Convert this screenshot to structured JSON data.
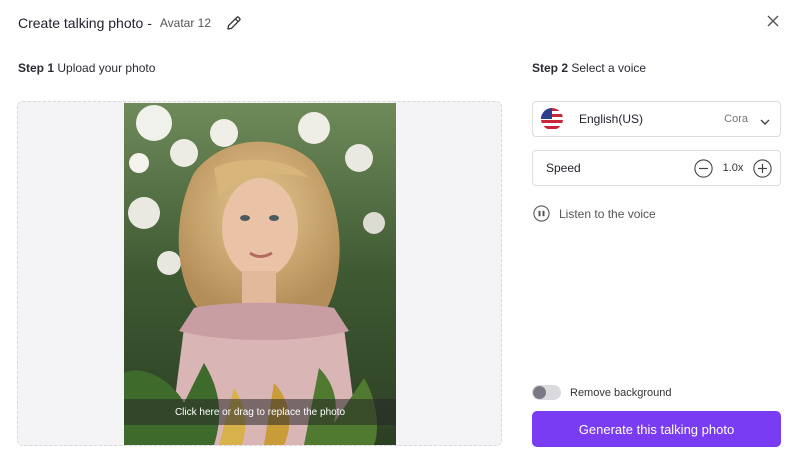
{
  "header": {
    "title": "Create talking photo -",
    "avatar_name": "Avatar 12",
    "edit_icon": "pencil-icon",
    "close_icon": "close-icon"
  },
  "step1": {
    "num": "Step 1",
    "label": "Upload your photo",
    "replace_text": "Click here or drag to replace the photo"
  },
  "step2": {
    "num": "Step 2",
    "label": "Select a voice",
    "voice": {
      "language": "English(US)",
      "name": "Cora",
      "flag_icon": "us-flag-icon"
    },
    "speed": {
      "label": "Speed",
      "value": "1.0x"
    },
    "listen_label": "Listen to the voice"
  },
  "remove_background": {
    "label": "Remove background",
    "enabled": false
  },
  "generate_label": "Generate this talking photo",
  "colors": {
    "accent": "#7a3cf2",
    "border": "#dcdce2"
  }
}
